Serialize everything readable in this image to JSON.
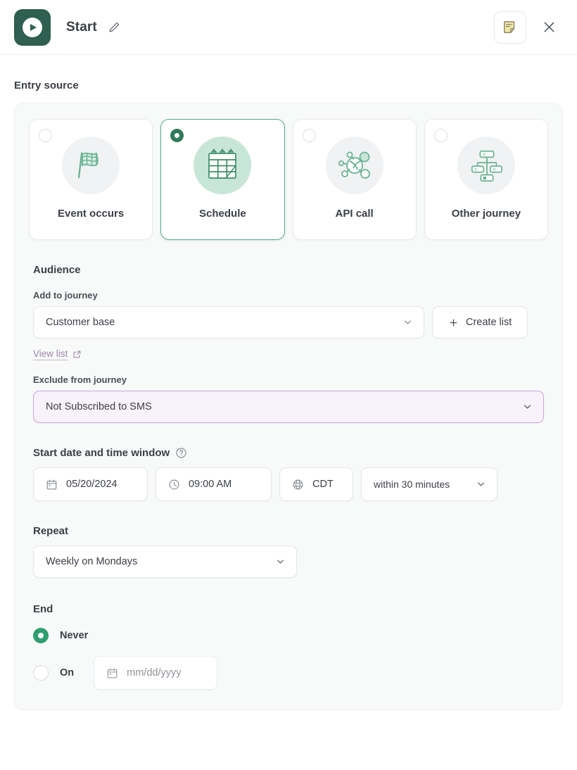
{
  "header": {
    "logo_icon": "play-circle-icon",
    "title": "Start",
    "edit_icon": "pencil-icon",
    "note_icon": "sticky-note-icon",
    "close_icon": "close-icon",
    "accent_color": "#2e5f50"
  },
  "entry_source": {
    "section_label": "Entry source",
    "selected_index": 1,
    "cards": [
      {
        "label": "Event occurs",
        "icon": "checkered-flag-icon",
        "selected": false
      },
      {
        "label": "Schedule",
        "icon": "calendar-icon",
        "selected": true
      },
      {
        "label": "API call",
        "icon": "api-network-icon",
        "selected": false
      },
      {
        "label": "Other journey",
        "icon": "org-chart-icon",
        "selected": false
      }
    ]
  },
  "audience": {
    "title": "Audience",
    "add_to_journey": {
      "label": "Add to journey",
      "value": "Customer base",
      "chevron_icon": "chevron-down-icon"
    },
    "create_list_button": {
      "label": "Create list",
      "icon": "plus-icon"
    },
    "view_list_link": {
      "label": "View list",
      "icon": "external-link-icon",
      "color": "#9b87aa"
    },
    "exclude_from_journey": {
      "label": "Exclude from journey",
      "value": "Not Subscribed to SMS",
      "chevron_icon": "chevron-down-icon",
      "border_color": "#c9a6da",
      "background_color": "#f8f2fa"
    }
  },
  "schedule": {
    "start_window": {
      "label": "Start date and time window",
      "help_icon": "question-circle-icon",
      "date": {
        "value": "05/20/2024",
        "icon": "calendar-icon"
      },
      "time": {
        "value": "09:00 AM",
        "icon": "clock-icon"
      },
      "timezone": {
        "value": "CDT",
        "icon": "globe-icon"
      },
      "window": {
        "value": "within 30 minutes",
        "chevron_icon": "chevron-down-icon"
      }
    },
    "repeat": {
      "label": "Repeat",
      "value": "Weekly on Mondays",
      "chevron_icon": "chevron-down-icon"
    },
    "end": {
      "label": "End",
      "options": [
        {
          "label": "Never",
          "selected": true
        },
        {
          "label": "On",
          "selected": false
        }
      ],
      "date_input": {
        "placeholder": "mm/dd/yyyy",
        "value": "",
        "icon": "calendar-icon"
      }
    }
  }
}
